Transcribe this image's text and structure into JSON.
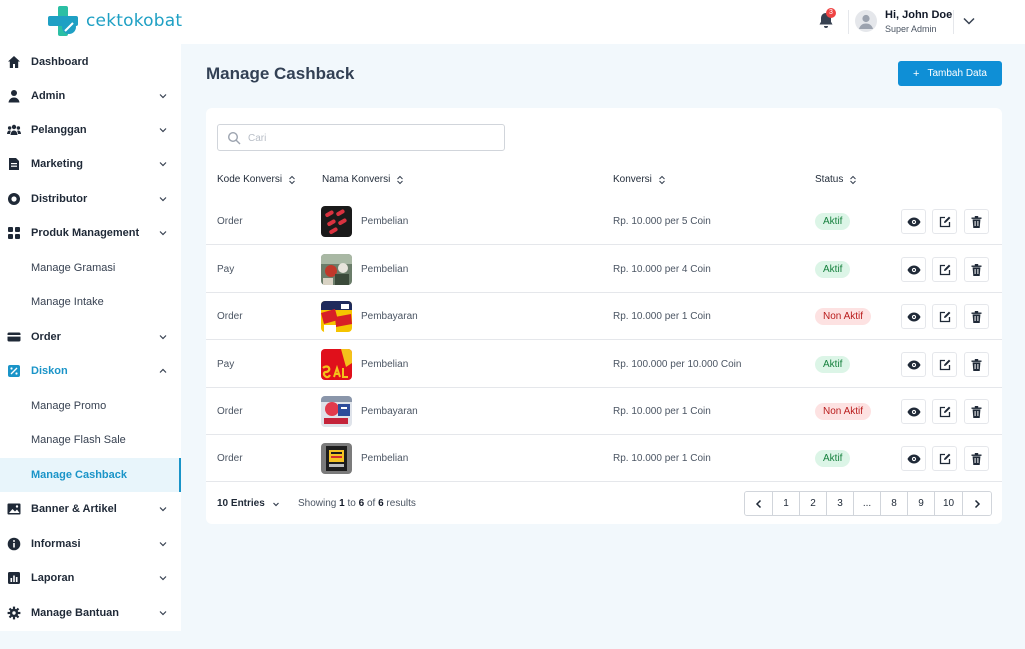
{
  "brand": {
    "name": "cektokobat",
    "accent": "#1a94c8",
    "primary_button": "#0f8fd6"
  },
  "header": {
    "notification_count": "3",
    "user_name": "Hi, John Doe",
    "user_role": "Super Admin"
  },
  "sidebar": {
    "items": [
      {
        "label": "Dashboard",
        "icon": "home-icon",
        "chevron": false
      },
      {
        "label": "Admin",
        "icon": "user-icon",
        "chevron": "down"
      },
      {
        "label": "Pelanggan",
        "icon": "users-icon",
        "chevron": "down"
      },
      {
        "label": "Marketing",
        "icon": "document-icon",
        "chevron": "down"
      },
      {
        "label": "Distributor",
        "icon": "circle-icon",
        "chevron": "down"
      },
      {
        "label": "Produk Management",
        "icon": "grid-icon",
        "chevron": "down"
      },
      {
        "label": "Manage Gramasi",
        "sub": true
      },
      {
        "label": "Manage Intake",
        "sub": true
      },
      {
        "label": "Order",
        "icon": "card-icon",
        "chevron": "down"
      },
      {
        "label": "Diskon",
        "icon": "percent-icon",
        "chevron": "up",
        "open": true
      },
      {
        "label": "Manage Promo",
        "sub": true
      },
      {
        "label": "Manage Flash Sale",
        "sub": true
      },
      {
        "label": "Manage Cashback",
        "sub": true,
        "active": true
      },
      {
        "label": "Banner & Artikel",
        "icon": "image-icon",
        "chevron": "down"
      },
      {
        "label": "Informasi",
        "icon": "info-icon",
        "chevron": "down"
      },
      {
        "label": "Laporan",
        "icon": "report-icon",
        "chevron": "down"
      },
      {
        "label": "Manage Bantuan",
        "icon": "gear-icon",
        "chevron": "down"
      }
    ]
  },
  "main": {
    "title": "Manage Cashback",
    "add_button": "Tambah Data",
    "search_placeholder": "Cari",
    "columns": [
      "Kode Konversi",
      "Nama Konversi",
      "Konversi",
      "Status"
    ],
    "rows": [
      {
        "kode": "Order",
        "nama": "Pembelian",
        "konversi": "Rp. 10.000 per 5 Coin",
        "status": "Aktif",
        "thumb": "pills"
      },
      {
        "kode": "Pay",
        "nama": "Pembelian",
        "konversi": "Rp. 10.000 per 4 Coin",
        "status": "Aktif",
        "thumb": "shop"
      },
      {
        "kode": "Order",
        "nama": "Pembayaran",
        "konversi": "Rp. 10.000 per 1 Coin",
        "status": "Non Aktif",
        "thumb": "sale-tags"
      },
      {
        "kode": "Pay",
        "nama": "Pembelian",
        "konversi": "Rp. 100.000 per 10.000 Coin",
        "status": "Aktif",
        "thumb": "sale"
      },
      {
        "kode": "Order",
        "nama": "Pembayaran",
        "konversi": "Rp. 10.000 per 1 Coin",
        "status": "Non Aktif",
        "thumb": "sale-sign"
      },
      {
        "kode": "Order",
        "nama": "Pembelian",
        "konversi": "Rp. 10.000 per 1 Coin",
        "status": "Aktif",
        "thumb": "sale-50"
      }
    ],
    "status_colors": {
      "Aktif": "#15803d",
      "Non Aktif": "#b91c1c"
    }
  },
  "footer": {
    "entries": "10 Entries",
    "showing_prefix": "Showing",
    "showing_from": "1",
    "showing_to_word": "to",
    "showing_to": "6",
    "showing_of_word": "of",
    "showing_total": "6",
    "showing_suffix": "results",
    "pages": [
      "1",
      "2",
      "3",
      "...",
      "8",
      "9",
      "10"
    ]
  }
}
